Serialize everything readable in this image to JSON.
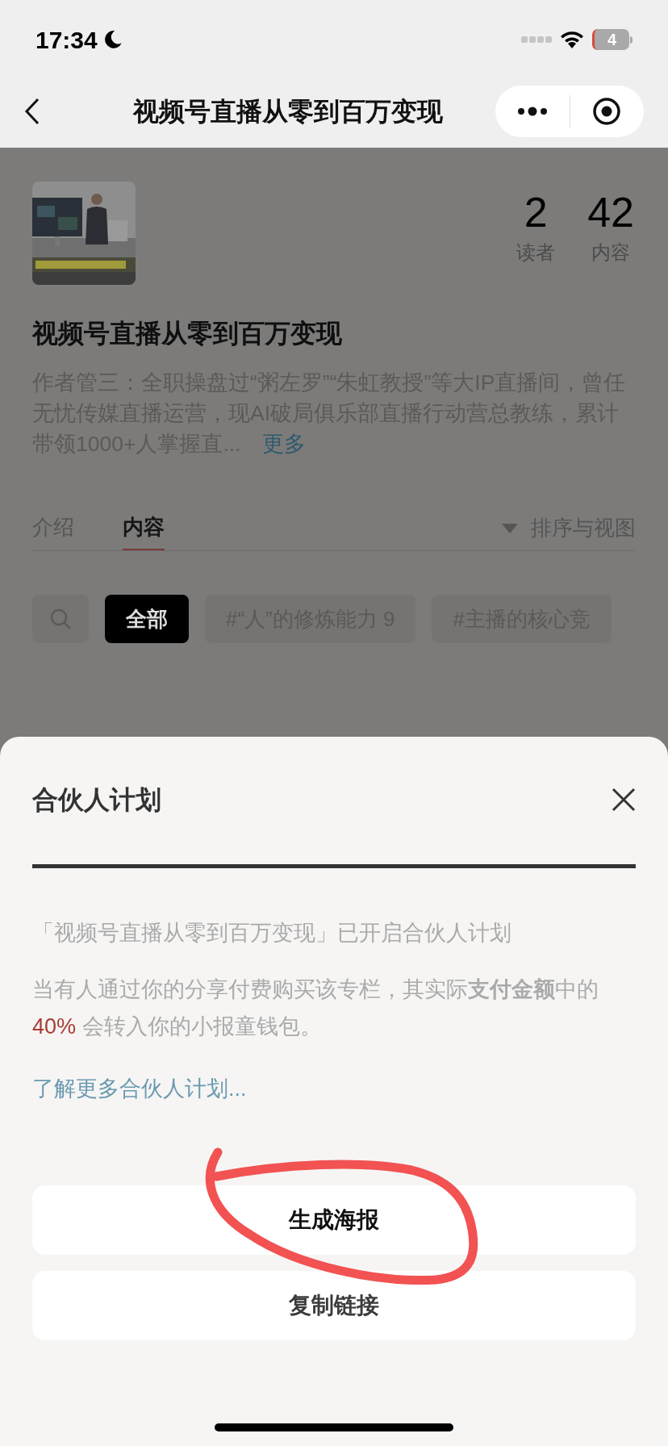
{
  "status_bar": {
    "time": "17:34",
    "battery": "4"
  },
  "nav": {
    "title": "视频号直播从零到百万变现"
  },
  "column": {
    "stats": [
      {
        "value": "2",
        "label": "读者"
      },
      {
        "value": "42",
        "label": "内容"
      }
    ],
    "title": "视频号直播从零到百万变现",
    "description": "作者管三：全职操盘过“粥左罗”“朱虹教授”等大IP直播间，曾任无忧传媒直播运营，现AI破局俱乐部直播行动营总教练，累计带领1000+人掌握直...",
    "more_link": "更多"
  },
  "tabs": [
    {
      "label": "介绍",
      "selected": false
    },
    {
      "label": "内容",
      "selected": true
    }
  ],
  "sort": {
    "label": "排序与视图"
  },
  "chips": [
    {
      "label": "全部",
      "selected": true
    },
    {
      "label": "#“人”的修炼能力 9",
      "selected": false
    },
    {
      "label": "#主播的核心竞",
      "selected": false
    }
  ],
  "sheet": {
    "title": "合伙人计划",
    "intro": "「视频号直播从零到百万变现」已开启合伙人计划",
    "commission": {
      "before": "当有人通过你的分享付费购买该专栏，其实际**支付金额**中的 ",
      "highlight": "40%",
      "after": " 会转入你的小报童钱包。"
    },
    "learn_more": "了解更多合伙人计划...",
    "buttons": [
      "生成海报",
      "复制链接"
    ]
  }
}
